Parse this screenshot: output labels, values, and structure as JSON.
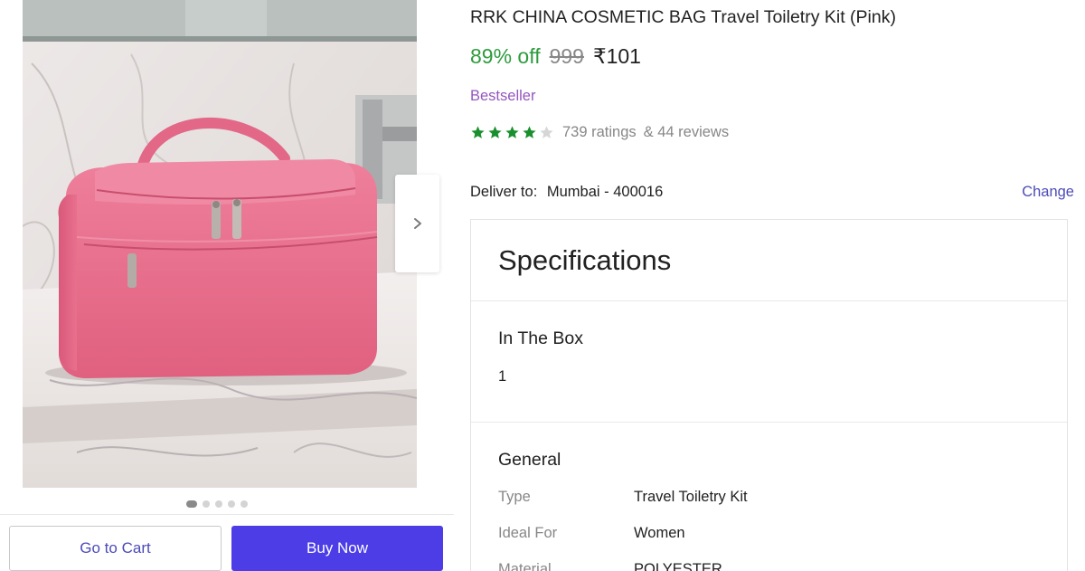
{
  "product": {
    "title": "RRK CHINA COSMETIC BAG Travel Toiletry Kit (Pink)",
    "discount": "89% off",
    "mrp": "999",
    "price": "₹101",
    "badge": "Bestseller",
    "rating_stars": 4,
    "rating_max": 5,
    "ratings_count": "739 ratings",
    "reviews_count": "& 44 reviews"
  },
  "gallery": {
    "image_count": 5,
    "active_index": 0,
    "next_icon": "chevron-right-icon"
  },
  "delivery": {
    "label": "Deliver to:",
    "location": "Mumbai - 400016",
    "change_label": "Change"
  },
  "specifications": {
    "title": "Specifications",
    "sections": [
      {
        "title": "In The Box",
        "value": "1"
      },
      {
        "title": "General",
        "rows": [
          {
            "key": "Type",
            "value": "Travel Toiletry Kit"
          },
          {
            "key": "Ideal For",
            "value": "Women"
          },
          {
            "key": "Material",
            "value": "POLYESTER"
          }
        ]
      }
    ]
  },
  "actions": {
    "cart_label": "Go to Cart",
    "buy_label": "Buy Now"
  },
  "colors": {
    "discount_green": "#2e9b3e",
    "badge_purple": "#9457bf",
    "star_green": "#1a8f2e",
    "link_indigo": "#4c4bb8",
    "buy_button": "#4c3de6"
  }
}
